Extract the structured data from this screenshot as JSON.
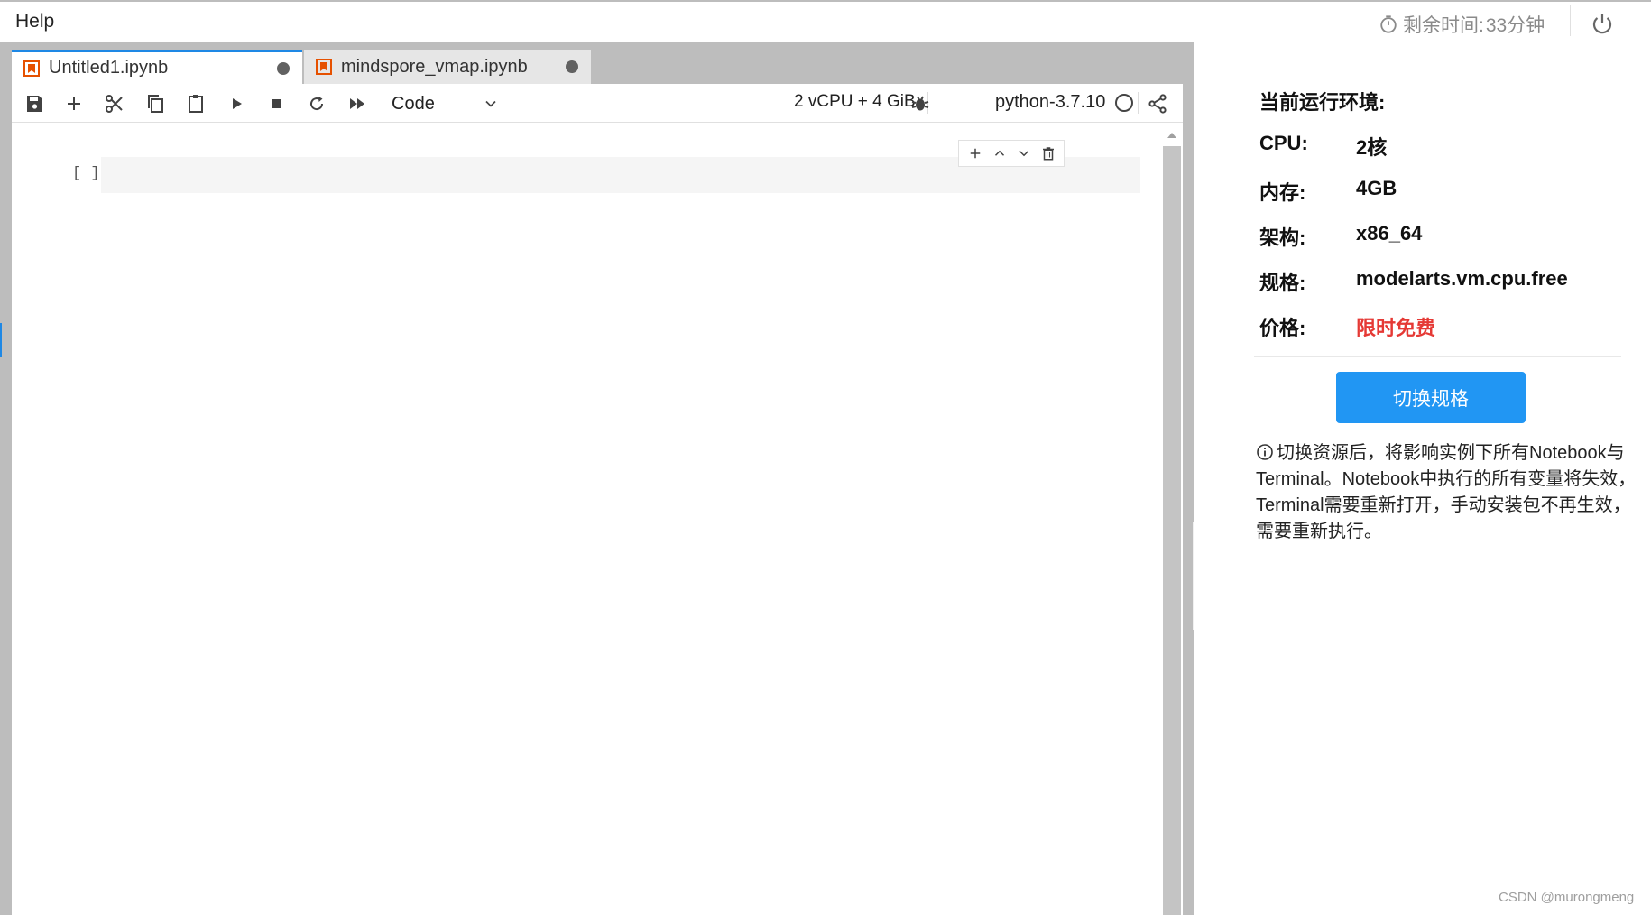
{
  "menu": {
    "help": "Help"
  },
  "timer": {
    "label": "剩余时间:",
    "value": "33分钟"
  },
  "tabs": [
    {
      "label": "Untitled1.ipynb",
      "active": true
    },
    {
      "label": "mindspore_vmap.ipynb",
      "active": false
    }
  ],
  "toolbar": {
    "cell_type": "Code",
    "resources": "2 vCPU + 4 GiB",
    "kernel": "python-3.7.10"
  },
  "cell": {
    "prompt": "[ ]"
  },
  "env": {
    "title": "当前运行环境:",
    "specs": [
      {
        "key": "CPU:",
        "value": "2核"
      },
      {
        "key": "内存:",
        "value": "4GB"
      },
      {
        "key": "架构:",
        "value": "x86_64"
      },
      {
        "key": "规格:",
        "value": "modelarts.vm.cpu.free"
      },
      {
        "key": "价格:",
        "value": "限时免费"
      }
    ],
    "switch_button": "切换规格",
    "notice": "切换资源后，将影响实例下所有Notebook与Terminal。Notebook中执行的所有变量将失效，Terminal需要重新打开，手动安装包不再生效，需要重新执行。"
  },
  "watermark": "CSDN @murongmeng",
  "colors": {
    "accent": "#2196f3",
    "price": "#e53935",
    "tab_icon": "#e65100"
  },
  "icons": [
    "timer-icon",
    "power-icon",
    "notebook-icon",
    "save-icon",
    "add-icon",
    "cut-icon",
    "copy-icon",
    "paste-icon",
    "run-icon",
    "stop-icon",
    "restart-icon",
    "run-all-icon",
    "chevron-down-icon",
    "bug-icon",
    "share-icon",
    "arrow-up-icon",
    "arrow-down-icon",
    "trash-icon",
    "info-icon",
    "caret-right-icon"
  ]
}
